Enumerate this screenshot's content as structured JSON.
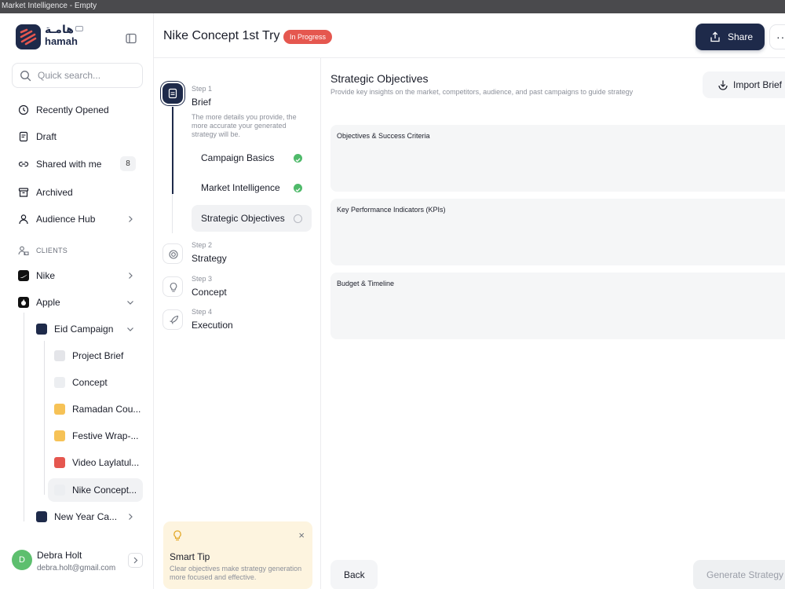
{
  "window": {
    "title": "Market Intelligence - Empty"
  },
  "brand": {
    "name_ar": "هامـة",
    "name_en": "hamah"
  },
  "search": {
    "placeholder": "Quick search..."
  },
  "nav": {
    "recently_opened": "Recently Opened",
    "draft": "Draft",
    "shared": "Shared with me",
    "shared_count": "8",
    "archived": "Archived",
    "audience_hub": "Audience Hub"
  },
  "clients": {
    "section_label": "CLIENTS",
    "items": [
      {
        "name": "Nike"
      },
      {
        "name": "Apple"
      }
    ],
    "apple_children": [
      {
        "name": "Eid Campaign"
      },
      {
        "name": "Project Brief"
      },
      {
        "name": "Concept"
      },
      {
        "name": "Ramadan Cou..."
      },
      {
        "name": "Festive Wrap-..."
      },
      {
        "name": "Video Laylatul..."
      },
      {
        "name": "Nike Concept..."
      },
      {
        "name": "New Year Ca..."
      }
    ]
  },
  "user": {
    "initial": "D",
    "name": "Debra Holt",
    "email": "debra.holt@gmail.com"
  },
  "header": {
    "title": "Nike Concept 1st Try",
    "status": "In Progress",
    "share": "Share",
    "more": "···"
  },
  "steps": [
    {
      "num": "Step 1",
      "name": "Brief",
      "desc": "The more details you provide, the more accurate your generated strategy will be."
    },
    {
      "num": "Step 2",
      "name": "Strategy"
    },
    {
      "num": "Step 3",
      "name": "Concept"
    },
    {
      "num": "Step 4",
      "name": "Execution"
    }
  ],
  "substeps": [
    {
      "label": "Campaign Basics",
      "state": "done"
    },
    {
      "label": "Market Intelligence",
      "state": "done"
    },
    {
      "label": "Strategic Objectives",
      "state": "current"
    }
  ],
  "tip": {
    "title": "Smart Tip",
    "text": "Clear objectives make strategy generation more focused and effective.",
    "close": "×"
  },
  "main": {
    "title": "Strategic Objectives",
    "subtitle": "Provide key insights on the market, competitors, audience, and past campaigns to guide strategy",
    "import": "Import Brief",
    "fields": [
      {
        "label": "Objectives & Success Criteria"
      },
      {
        "label": "Key Performance Indicators (KPIs)"
      },
      {
        "label": "Budget & Timeline"
      }
    ],
    "back": "Back",
    "generate": "Generate Strategy"
  },
  "colors": {
    "primary": "#1e2a4a",
    "danger": "#e5574f",
    "success": "#4fba6a",
    "tip_bg": "#fdf4df"
  }
}
